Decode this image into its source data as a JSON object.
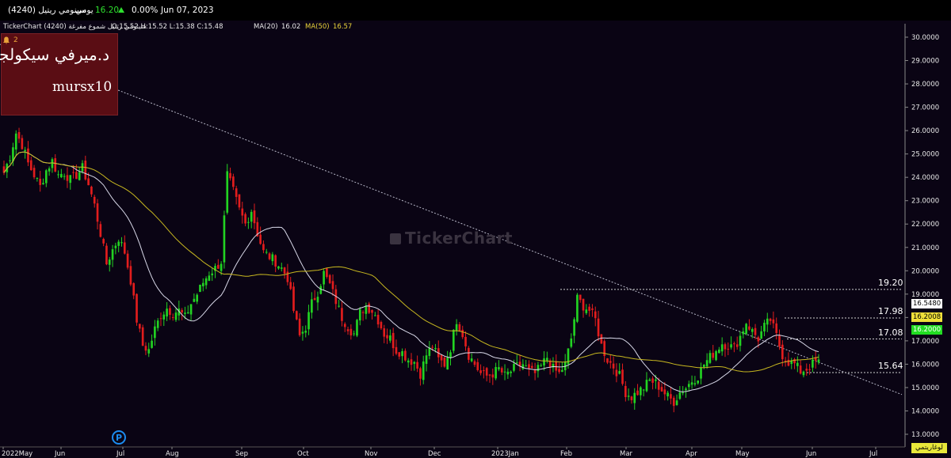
{
  "header": {
    "symbol_name": "سينومي ريتيل (4240)",
    "period": "يومي",
    "last_price": "16.20",
    "change_pct": "0.00%",
    "date": "Jun 07, 2023"
  },
  "subheader": {
    "source": "TickerChart سينومي ريتيل شموع مفرغة (4240)",
    "ohlc": "O:15.52 H:15.52 L:15.38 C:15.48",
    "ma20_label": "MA(20)",
    "ma20_value": "16.02",
    "ma50_label": "MA(50)",
    "ma50_value": "16.57"
  },
  "alert_badge": {
    "icon": "bell-icon",
    "count": "2"
  },
  "watermark_box": {
    "line1": "د.ميرفي سيكولجي",
    "line2": "mursx10"
  },
  "brand_watermark": "TickerChart",
  "p_icon": "P",
  "mode_button": "لوغاريتمي",
  "colors": {
    "background": "#0a0414",
    "up_candle": "#22d322",
    "down_candle": "#e21d1d",
    "ma20": "#d8d8e8",
    "ma50": "#c8b820",
    "trendline": "#b8b8c8",
    "watermark_box": "#5a0d14",
    "price_badge_yellow": "#f0e03a",
    "price_badge_green": "#22dd22"
  },
  "price_badges": [
    {
      "value": "16.5480",
      "style": "white"
    },
    {
      "value": "16.2008",
      "style": "yellow"
    },
    {
      "value": "16.2000",
      "style": "green"
    }
  ],
  "chart_data": {
    "type": "candlestick",
    "y_axis": {
      "min": 12.8,
      "max": 30.2,
      "ticks": [
        "30.0000",
        "29.0000",
        "28.0000",
        "27.0000",
        "26.0000",
        "25.0000",
        "24.0000",
        "23.0000",
        "22.0000",
        "21.0000",
        "20.0000",
        "19.0000",
        "18.0000",
        "17.0000",
        "16.0000",
        "15.0000",
        "14.0000",
        "13.0000"
      ]
    },
    "x_axis": {
      "ticks": [
        "2022May",
        "Jun",
        "Jul",
        "Aug",
        "Sep",
        "Oct",
        "Nov",
        "Dec",
        "2023Jan",
        "Feb",
        "Mar",
        "Apr",
        "May",
        "Jun",
        "Jul"
      ]
    },
    "grid": false,
    "indicators": [
      {
        "name": "MA(20)",
        "value": 16.02
      },
      {
        "name": "MA(50)",
        "value": 16.57
      }
    ],
    "levels": [
      19.2,
      17.98,
      17.08,
      15.64
    ],
    "level_labels": [
      "19.20",
      "17.98",
      "17.08",
      "15.64"
    ],
    "trendline": {
      "from": {
        "date": "2022-05-01",
        "price": 26.2
      },
      "to": {
        "date": "2023-07-18",
        "price": 14.7
      }
    },
    "closes": [
      24.2,
      24.9,
      25.9,
      25.4,
      24.6,
      24.1,
      23.6,
      24.3,
      24.7,
      24.1,
      24.2,
      23.9,
      24.1,
      24.4,
      23.7,
      22.8,
      21.6,
      20.3,
      20.9,
      21.4,
      20.8,
      19.6,
      17.9,
      16.8,
      16.6,
      17.5,
      18.1,
      18.4,
      18.2,
      18.3,
      18.0,
      18.6,
      19.0,
      19.5,
      19.9,
      20.1,
      20.4,
      24.1,
      23.4,
      22.6,
      22.0,
      22.6,
      21.6,
      20.8,
      20.6,
      20.4,
      20.1,
      19.7,
      18.3,
      17.2,
      17.6,
      18.6,
      19.1,
      19.9,
      19.4,
      18.7,
      18.0,
      17.6,
      17.3,
      18.2,
      18.5,
      18.3,
      17.9,
      17.3,
      17.1,
      16.6,
      16.5,
      16.2,
      16.1,
      15.6,
      16.4,
      16.8,
      16.2,
      16.0,
      16.7,
      17.9,
      17.3,
      16.4,
      16.0,
      15.6,
      15.5,
      15.6,
      15.8,
      15.5,
      15.7,
      15.9,
      16.0,
      15.7,
      15.6,
      15.9,
      16.3,
      15.8,
      15.6,
      16.0,
      17.1,
      18.8,
      18.5,
      18.3,
      17.9,
      16.8,
      16.2,
      15.9,
      15.5,
      14.8,
      14.6,
      14.8,
      15.0,
      15.3,
      15.2,
      14.9,
      14.6,
      14.4,
      14.8,
      15.0,
      15.3,
      15.5,
      16.0,
      16.3,
      16.6,
      16.9,
      16.8,
      16.7,
      17.2,
      17.8,
      17.4,
      17.1,
      17.6,
      17.9,
      17.2,
      16.4,
      16.1,
      16.0,
      15.7,
      15.8,
      16.0,
      16.2
    ],
    "dates_from": "2022-05-01",
    "dates_to": "2023-06-07"
  }
}
